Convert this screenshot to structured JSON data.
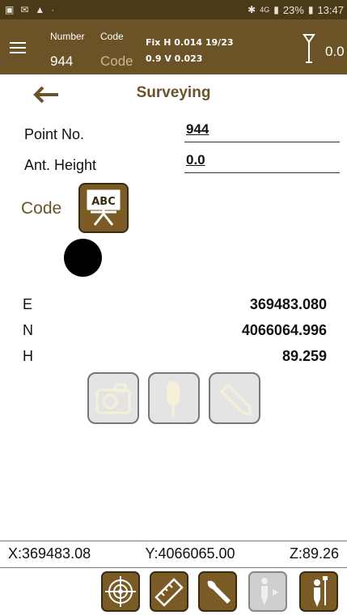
{
  "status_bar": {
    "network": "4G",
    "battery": "23%",
    "time": "13:47"
  },
  "header": {
    "number_label": "Number",
    "number_value": "944",
    "code_label": "Code",
    "code_value": "Code",
    "fix_line1": "Fix H 0.014  19/23",
    "fix_line2": "0.9 V 0.023",
    "antenna_value": "0.0"
  },
  "page": {
    "title": "Surveying"
  },
  "form": {
    "point_label": "Point No.",
    "point_value": "944",
    "ant_label": "Ant. Height",
    "ant_value": "0.0",
    "code_label": "Code"
  },
  "coords": {
    "e_label": "E",
    "e_value": "369483.080",
    "n_label": "N",
    "n_value": "4066064.996",
    "h_label": "H",
    "h_value": "89.259"
  },
  "footer": {
    "x": "X:369483.08",
    "y": "Y:4066065.00",
    "z": "Z:89.26"
  },
  "icons": {
    "tools": [
      "camera-icon",
      "microphone-icon",
      "pencil-icon"
    ],
    "bottom": [
      "target-icon",
      "ruler-icon",
      "wrench-icon",
      "stakeout-icon",
      "survey-person-icon"
    ]
  },
  "colors": {
    "header_bg": "#6b5327",
    "status_bg": "#4a3a17",
    "accent": "#7a5a25",
    "title": "#6b5327"
  }
}
